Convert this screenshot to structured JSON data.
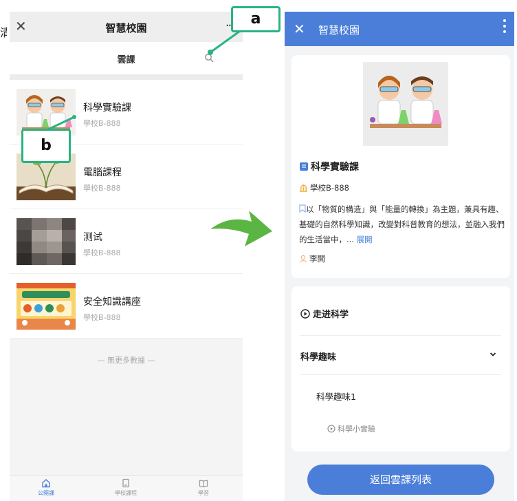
{
  "left_screen": {
    "header": {
      "title": "智慧校園",
      "close_glyph": "✕",
      "more_glyph": "···"
    },
    "subheader": {
      "title": "雲課",
      "search_icon": "search-icon"
    },
    "courses": [
      {
        "title": "科學實驗課",
        "school": "學校B-888"
      },
      {
        "title": "電腦課程",
        "school": "學校B-888"
      },
      {
        "title": "测试",
        "school": "學校B-888"
      },
      {
        "title": "安全知識講座",
        "school": "學校B-888"
      }
    ],
    "no_more": "— 無更多數據 —",
    "tabs": [
      {
        "label": "公開課",
        "icon": "home-icon",
        "active": true
      },
      {
        "label": "學校課程",
        "icon": "tablet-icon",
        "active": false
      },
      {
        "label": "學習",
        "icon": "book-icon",
        "active": false
      }
    ]
  },
  "annotations": {
    "a": "a",
    "b": "b"
  },
  "right_screen": {
    "header": {
      "title": "智慧校園",
      "close_glyph": "✕"
    },
    "course": {
      "title": "科學實驗課",
      "school": "學校B-888",
      "description": "以「物質的構造」與「能量的轉換」為主題，兼具有趣、基礎的自然科學知識，改變對科普教育的想法，並融入我們的生活當中，... ",
      "expand_label": "展開",
      "teacher": "李開"
    },
    "chapters": {
      "chapter1": "走进科学",
      "chapter2": "科學趣味",
      "sub_item": "科學趣味1",
      "lesson": "科學小實驗"
    },
    "back_button": "返回雲課列表"
  },
  "colors": {
    "accent": "#4a7ed9",
    "annotation": "#29b383",
    "arrow": "#5bb543"
  }
}
